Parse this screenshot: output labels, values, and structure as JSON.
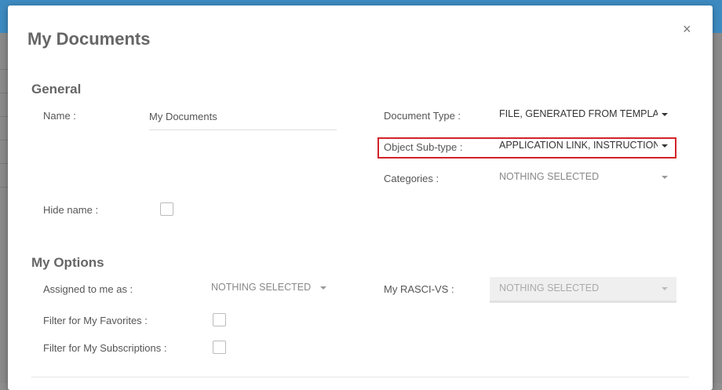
{
  "dialog": {
    "title": "My Documents",
    "close_label": "×"
  },
  "general": {
    "heading": "General",
    "name_label": "Name :",
    "name_value": "My Documents",
    "hide_name_label": "Hide name :",
    "document_type_label": "Document Type :",
    "document_type_value": "FILE, GENERATED FROM TEMPLATE",
    "object_subtype_label": "Object Sub-type :",
    "object_subtype_value": "APPLICATION LINK, INSTRUCTIONS",
    "categories_label": "Categories :",
    "categories_value": "NOTHING SELECTED"
  },
  "my_options": {
    "heading": "My Options",
    "assigned_label": "Assigned to me as :",
    "assigned_value": "NOTHING SELECTED",
    "rasci_label": "My RASCI-VS :",
    "rasci_value": "NOTHING SELECTED",
    "favorites_label": "Filter for My Favorites :",
    "subscriptions_label": "Filter for My Subscriptions :"
  },
  "colors": {
    "highlight": "#d2232a",
    "header_blue": "#3d8ac0"
  }
}
